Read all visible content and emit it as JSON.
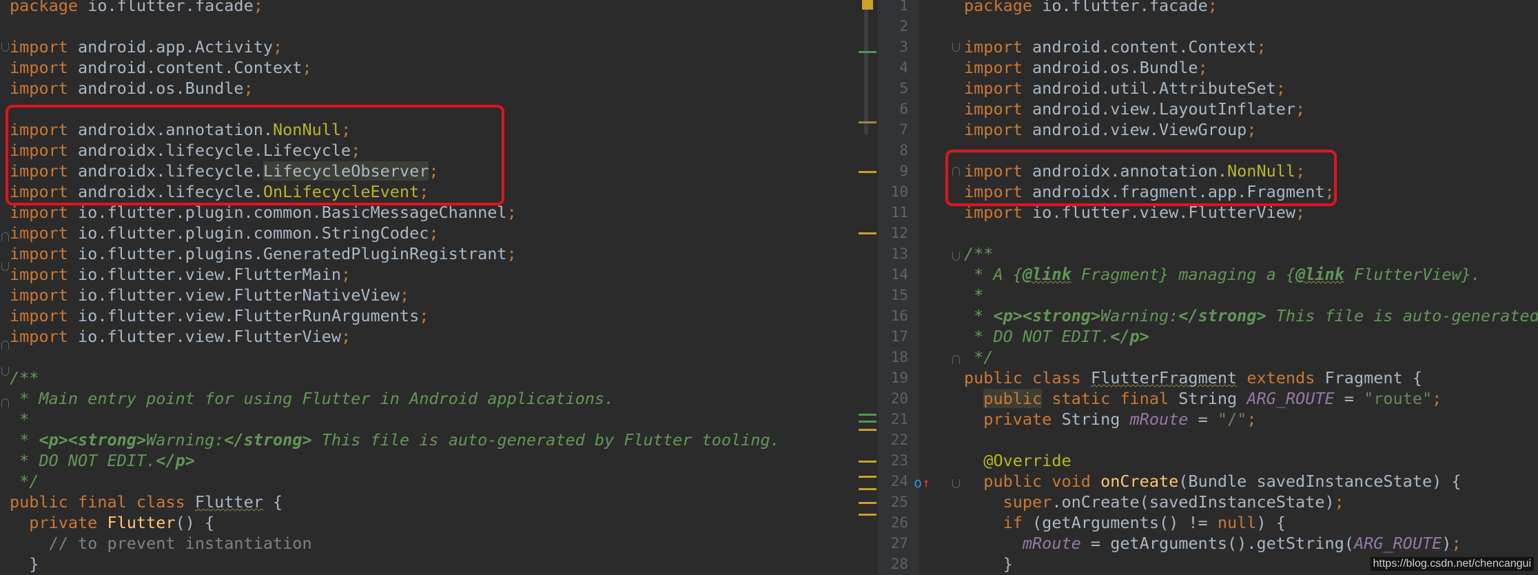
{
  "left": {
    "lines": [
      {
        "parts": [
          {
            "t": "package",
            "c": "kw"
          },
          {
            "t": " io.flutter.facade"
          },
          {
            "t": ";",
            "c": "kw"
          }
        ]
      },
      {
        "parts": []
      },
      {
        "parts": [
          {
            "t": "import",
            "c": "kw"
          },
          {
            "t": " android.app.Activity"
          },
          {
            "t": ";",
            "c": "kw"
          }
        ]
      },
      {
        "parts": [
          {
            "t": "import",
            "c": "kw"
          },
          {
            "t": " android.content.Context"
          },
          {
            "t": ";",
            "c": "kw"
          }
        ]
      },
      {
        "parts": [
          {
            "t": "import",
            "c": "kw"
          },
          {
            "t": " android.os.Bundle"
          },
          {
            "t": ";",
            "c": "kw"
          }
        ]
      },
      {
        "parts": []
      },
      {
        "parts": [
          {
            "t": "import",
            "c": "kw"
          },
          {
            "t": " androidx.annotation."
          },
          {
            "t": "NonNull",
            "c": "ann"
          },
          {
            "t": ";",
            "c": "kw"
          }
        ]
      },
      {
        "parts": [
          {
            "t": "import",
            "c": "kw"
          },
          {
            "t": " androidx.lifecycle.Lifecycle"
          },
          {
            "t": ";",
            "c": "kw"
          }
        ]
      },
      {
        "parts": [
          {
            "t": "import",
            "c": "kw"
          },
          {
            "t": " androidx.lifecycle."
          },
          {
            "t": "LifecycleObserver",
            "c": "hl"
          },
          {
            "t": ";",
            "c": "kw"
          }
        ]
      },
      {
        "parts": [
          {
            "t": "import",
            "c": "kw"
          },
          {
            "t": " androidx.lifecycle."
          },
          {
            "t": "OnLifecycleEvent",
            "c": "ann"
          },
          {
            "t": ";",
            "c": "kw"
          }
        ]
      },
      {
        "parts": [
          {
            "t": "import",
            "c": "kw"
          },
          {
            "t": " io.flutter.plugin.common.BasicMessageChannel"
          },
          {
            "t": ";",
            "c": "kw"
          }
        ]
      },
      {
        "parts": [
          {
            "t": "import",
            "c": "kw"
          },
          {
            "t": " io.flutter.plugin.common.StringCodec"
          },
          {
            "t": ";",
            "c": "kw"
          }
        ]
      },
      {
        "parts": [
          {
            "t": "import",
            "c": "kw"
          },
          {
            "t": " io.flutter.plugins.GeneratedPluginRegistrant"
          },
          {
            "t": ";",
            "c": "kw"
          }
        ]
      },
      {
        "parts": [
          {
            "t": "import",
            "c": "kw"
          },
          {
            "t": " io.flutter.view.FlutterMain"
          },
          {
            "t": ";",
            "c": "kw"
          }
        ]
      },
      {
        "parts": [
          {
            "t": "import",
            "c": "kw"
          },
          {
            "t": " io.flutter.view.FlutterNativeView"
          },
          {
            "t": ";",
            "c": "kw"
          }
        ]
      },
      {
        "parts": [
          {
            "t": "import",
            "c": "kw"
          },
          {
            "t": " io.flutter.view.FlutterRunArguments"
          },
          {
            "t": ";",
            "c": "kw"
          }
        ]
      },
      {
        "parts": [
          {
            "t": "import",
            "c": "kw"
          },
          {
            "t": " io.flutter.view.FlutterView"
          },
          {
            "t": ";",
            "c": "kw"
          }
        ]
      },
      {
        "parts": []
      },
      {
        "parts": [
          {
            "t": "/**",
            "c": "cm"
          }
        ]
      },
      {
        "parts": [
          {
            "t": " * Main entry point for using Flutter in Android applications.",
            "c": "cm"
          }
        ]
      },
      {
        "parts": [
          {
            "t": " *",
            "c": "cm"
          }
        ]
      },
      {
        "parts": [
          {
            "t": " * ",
            "c": "cm"
          },
          {
            "t": "<p><strong>",
            "c": "cm tag"
          },
          {
            "t": "Warning:",
            "c": "cm"
          },
          {
            "t": "</strong>",
            "c": "cm tag"
          },
          {
            "t": " This file is auto-generated by Flutter tooling.",
            "c": "cm"
          }
        ]
      },
      {
        "parts": [
          {
            "t": " * DO NOT EDIT.",
            "c": "cm"
          },
          {
            "t": "</p>",
            "c": "cm tag"
          }
        ]
      },
      {
        "parts": [
          {
            "t": " */",
            "c": "cm"
          }
        ]
      },
      {
        "parts": [
          {
            "t": "public final class ",
            "c": "kw"
          },
          {
            "t": "Flutter",
            "c": "uw"
          },
          {
            "t": " {"
          }
        ]
      },
      {
        "parts": [
          {
            "t": "  private ",
            "c": "kw"
          },
          {
            "t": "Flutter",
            "c": "fn"
          },
          {
            "t": "() {"
          }
        ]
      },
      {
        "parts": [
          {
            "t": "    // to prevent instantiation",
            "c": "lc"
          }
        ]
      },
      {
        "parts": [
          {
            "t": "  }"
          }
        ]
      }
    ]
  },
  "right": {
    "line_numbers": [
      "1",
      "2",
      "3",
      "4",
      "5",
      "6",
      "7",
      "8",
      "9",
      "10",
      "11",
      "12",
      "13",
      "14",
      "15",
      "16",
      "17",
      "18",
      "19",
      "20",
      "21",
      "22",
      "23",
      "24",
      "25",
      "26",
      "27",
      "28"
    ],
    "lines": [
      {
        "parts": [
          {
            "t": "package",
            "c": "kw"
          },
          {
            "t": " io.flutter.facade"
          },
          {
            "t": ";",
            "c": "kw"
          }
        ]
      },
      {
        "parts": []
      },
      {
        "parts": [
          {
            "t": "import",
            "c": "kw"
          },
          {
            "t": " android.content.Context"
          },
          {
            "t": ";",
            "c": "kw"
          }
        ]
      },
      {
        "parts": [
          {
            "t": "import",
            "c": "kw"
          },
          {
            "t": " android.os.Bundle"
          },
          {
            "t": ";",
            "c": "kw"
          }
        ]
      },
      {
        "parts": [
          {
            "t": "import",
            "c": "kw"
          },
          {
            "t": " android.util.AttributeSet"
          },
          {
            "t": ";",
            "c": "kw"
          }
        ]
      },
      {
        "parts": [
          {
            "t": "import",
            "c": "kw"
          },
          {
            "t": " android.view.LayoutInflater"
          },
          {
            "t": ";",
            "c": "kw"
          }
        ]
      },
      {
        "parts": [
          {
            "t": "import",
            "c": "kw"
          },
          {
            "t": " android.view.ViewGroup"
          },
          {
            "t": ";",
            "c": "kw"
          }
        ]
      },
      {
        "parts": []
      },
      {
        "parts": [
          {
            "t": "import",
            "c": "kw"
          },
          {
            "t": " androidx.annotation."
          },
          {
            "t": "NonNull",
            "c": "ann"
          },
          {
            "t": ";",
            "c": "kw"
          }
        ]
      },
      {
        "parts": [
          {
            "t": "import",
            "c": "kw"
          },
          {
            "t": " androidx.fragment.app.Fragment"
          },
          {
            "t": ";",
            "c": "kw"
          }
        ]
      },
      {
        "parts": [
          {
            "t": "import",
            "c": "kw"
          },
          {
            "t": " io.flutter.view.FlutterView"
          },
          {
            "t": ";",
            "c": "kw"
          }
        ]
      },
      {
        "parts": []
      },
      {
        "parts": [
          {
            "t": "/**",
            "c": "cm"
          }
        ]
      },
      {
        "parts": [
          {
            "t": " * A {",
            "c": "cm"
          },
          {
            "t": "@link",
            "c": "cm tag uw"
          },
          {
            "t": " Fragment} managing a {",
            "c": "cm"
          },
          {
            "t": "@link",
            "c": "cm tag uw"
          },
          {
            "t": " FlutterView}.",
            "c": "cm"
          }
        ]
      },
      {
        "parts": [
          {
            "t": " *",
            "c": "cm"
          }
        ]
      },
      {
        "parts": [
          {
            "t": " * ",
            "c": "cm"
          },
          {
            "t": "<p><strong>",
            "c": "cm tag"
          },
          {
            "t": "Warning:",
            "c": "cm"
          },
          {
            "t": "</strong>",
            "c": "cm tag"
          },
          {
            "t": " This file is auto-generated",
            "c": "cm"
          }
        ]
      },
      {
        "parts": [
          {
            "t": " * DO NOT EDIT.",
            "c": "cm"
          },
          {
            "t": "</p>",
            "c": "cm tag"
          }
        ]
      },
      {
        "parts": [
          {
            "t": " */",
            "c": "cm"
          }
        ]
      },
      {
        "parts": [
          {
            "t": "public class ",
            "c": "kw"
          },
          {
            "t": "FlutterFragment",
            "c": "uw"
          },
          {
            "t": " extends ",
            "c": "kw"
          },
          {
            "t": "Fragment {"
          }
        ]
      },
      {
        "parts": [
          {
            "t": "  "
          },
          {
            "t": "public",
            "c": "kw hl"
          },
          {
            "t": " static final ",
            "c": "kw"
          },
          {
            "t": "String "
          },
          {
            "t": "ARG_ROUTE",
            "c": "fld"
          },
          {
            "t": " = "
          },
          {
            "t": "\"route\"",
            "c": "str"
          },
          {
            "t": ";",
            "c": "kw"
          }
        ]
      },
      {
        "parts": [
          {
            "t": "  private ",
            "c": "kw"
          },
          {
            "t": "String "
          },
          {
            "t": "mRoute",
            "c": "fld"
          },
          {
            "t": " = "
          },
          {
            "t": "\"/\"",
            "c": "str"
          },
          {
            "t": ";",
            "c": "kw"
          }
        ]
      },
      {
        "parts": []
      },
      {
        "parts": [
          {
            "t": "  "
          },
          {
            "t": "@Override",
            "c": "ann"
          }
        ]
      },
      {
        "parts": [
          {
            "t": "  public void ",
            "c": "kw"
          },
          {
            "t": "onCreate",
            "c": "fn"
          },
          {
            "t": "(Bundle savedInstanceState) {"
          }
        ]
      },
      {
        "parts": [
          {
            "t": "    "
          },
          {
            "t": "super",
            "c": "kw"
          },
          {
            "t": ".onCreate(savedInstanceState)"
          },
          {
            "t": ";",
            "c": "kw"
          }
        ]
      },
      {
        "parts": [
          {
            "t": "    "
          },
          {
            "t": "if",
            "c": "kw"
          },
          {
            "t": " (getArguments() != "
          },
          {
            "t": "null",
            "c": "kw"
          },
          {
            "t": ") {"
          }
        ]
      },
      {
        "parts": [
          {
            "t": "      "
          },
          {
            "t": "mRoute",
            "c": "fld"
          },
          {
            "t": " = getArguments().getString("
          },
          {
            "t": "ARG_ROUTE",
            "c": "fld"
          },
          {
            "t": ")"
          },
          {
            "t": ";",
            "c": "kw"
          }
        ]
      },
      {
        "parts": [
          {
            "t": "    }"
          }
        ]
      }
    ]
  },
  "override_icon": "override-method-icon",
  "watermark": "https://blog.csdn.net/chencangui"
}
